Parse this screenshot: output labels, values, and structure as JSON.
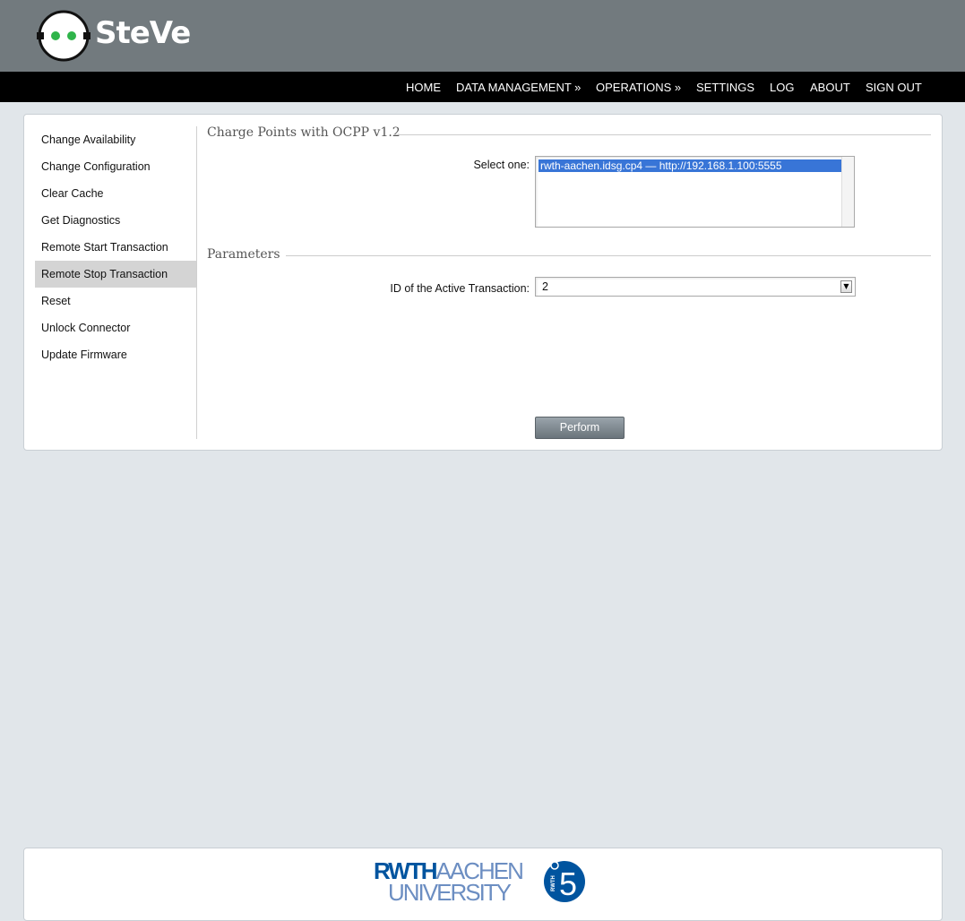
{
  "app": {
    "brand": "SteVe"
  },
  "nav": {
    "items": [
      {
        "label": "HOME"
      },
      {
        "label": "DATA MANAGEMENT »"
      },
      {
        "label": "OPERATIONS »"
      },
      {
        "label": "SETTINGS"
      },
      {
        "label": "LOG"
      },
      {
        "label": "ABOUT"
      },
      {
        "label": "SIGN OUT"
      }
    ]
  },
  "sidebar": {
    "items": [
      {
        "label": "Change Availability"
      },
      {
        "label": "Change Configuration"
      },
      {
        "label": "Clear Cache"
      },
      {
        "label": "Get Diagnostics"
      },
      {
        "label": "Remote Start Transaction"
      },
      {
        "label": "Remote Stop Transaction",
        "active": true
      },
      {
        "label": "Reset"
      },
      {
        "label": "Unlock Connector"
      },
      {
        "label": "Update Firmware"
      }
    ]
  },
  "charge_points": {
    "section_title": "Charge Points with OCPP v1.2",
    "select_label": "Select one:",
    "options": [
      {
        "label": "rwth-aachen.idsg.cp4 — http://192.168.1.100:5555",
        "selected": true
      }
    ]
  },
  "parameters": {
    "section_title": "Parameters",
    "transaction_label": "ID of the Active Transaction:",
    "transaction_value": "2"
  },
  "actions": {
    "perform_label": "Perform"
  },
  "footer": {
    "rwth_line1_bold": "RWTH",
    "rwth_line1_thin": "AACHEN",
    "rwth_line2": "UNIVERSITY",
    "i5_number": "5",
    "i5_text": "RWTH"
  },
  "colors": {
    "header_bg": "#727a7e",
    "navbar_bg": "#000000",
    "page_bg": "#e1e6ea",
    "selection": "#3875d7",
    "logo_green": "#2fb44a",
    "rwth_blue": "#00549f"
  }
}
